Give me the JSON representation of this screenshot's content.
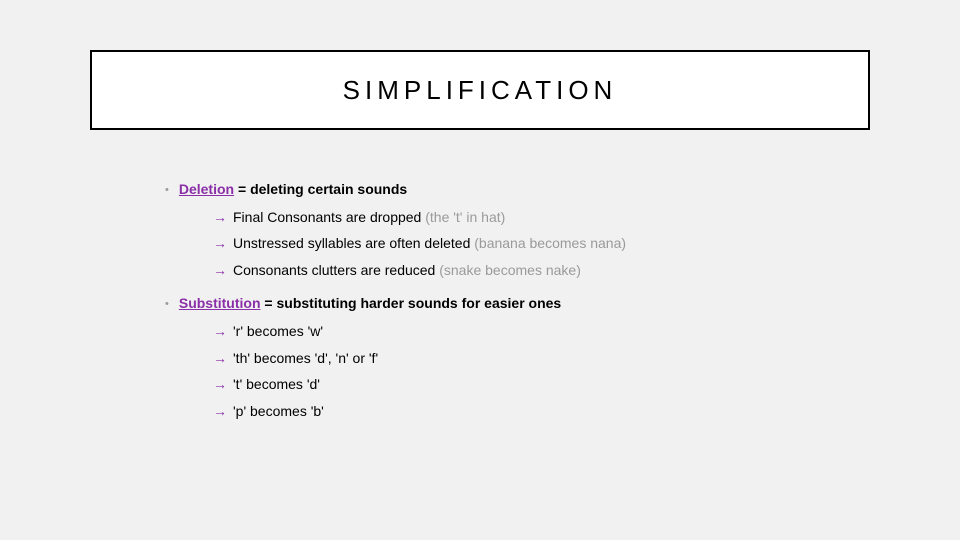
{
  "title": "SIMPLIFICATION",
  "bullets": [
    {
      "term": "Deletion",
      "connector": " = ",
      "definition": "deleting certain sounds",
      "subs": [
        {
          "text": "Final Consonants are dropped ",
          "muted": "(the 't' in hat)"
        },
        {
          "text": "Unstressed syllables are often deleted ",
          "muted": "(banana becomes nana)"
        },
        {
          "text": "Consonants clutters are reduced ",
          "muted": "(snake becomes nake)"
        }
      ]
    },
    {
      "term": "Substitution",
      "connector": " = ",
      "definition": "substituting harder sounds for easier ones",
      "subs": [
        {
          "text": "'r' becomes 'w'",
          "muted": ""
        },
        {
          "text": "'th' becomes 'd', 'n' or 'f'",
          "muted": ""
        },
        {
          "text": "'t' becomes 'd'",
          "muted": ""
        },
        {
          "text": "'p' becomes 'b'",
          "muted": ""
        }
      ]
    }
  ]
}
